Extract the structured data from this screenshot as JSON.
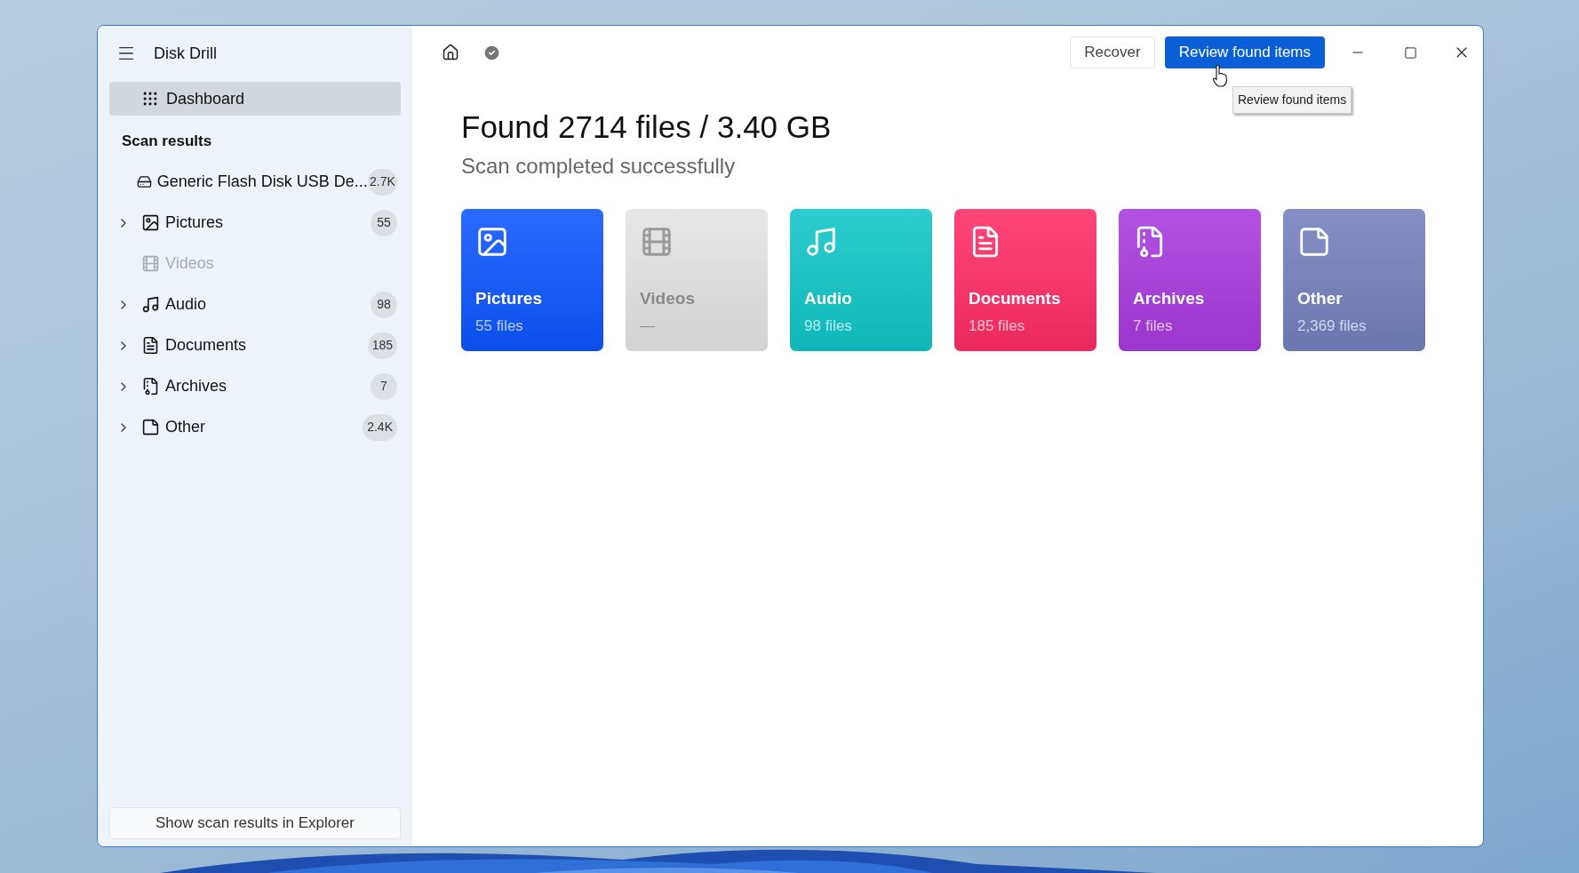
{
  "app": {
    "title": "Disk Drill"
  },
  "sidebar": {
    "items": [
      {
        "label": "Dashboard",
        "kind": "dashboard",
        "selected": true
      }
    ],
    "section_title": "Scan results",
    "results": [
      {
        "label": "Generic Flash Disk USB De...",
        "kind": "drive",
        "count": "2.7K",
        "expandable": false,
        "disabled": false
      },
      {
        "label": "Pictures",
        "kind": "pictures",
        "count": "55",
        "expandable": true,
        "disabled": false
      },
      {
        "label": "Videos",
        "kind": "videos",
        "expandable": false,
        "disabled": true
      },
      {
        "label": "Audio",
        "kind": "audio",
        "count": "98",
        "expandable": true,
        "disabled": false
      },
      {
        "label": "Documents",
        "kind": "documents",
        "count": "185",
        "expandable": true,
        "disabled": false
      },
      {
        "label": "Archives",
        "kind": "archives",
        "count": "7",
        "expandable": true,
        "disabled": false
      },
      {
        "label": "Other",
        "kind": "other",
        "count": "2.4K",
        "expandable": true,
        "disabled": false
      }
    ],
    "footer_button": "Show scan results in Explorer"
  },
  "toolbar": {
    "buttons": [
      "Recover",
      "Review found items"
    ],
    "tooltip": "Review found items"
  },
  "summary": {
    "title": "Found 2714 files / 3.40 GB",
    "subtitle": "Scan completed successfully"
  },
  "cards": [
    {
      "kind": "pictures",
      "title": "Pictures",
      "detail": "55 files",
      "color": "#0d55ff",
      "disabled": false
    },
    {
      "kind": "videos",
      "title": "Videos",
      "detail": "—",
      "color": "#e4e4e4",
      "disabled": true
    },
    {
      "kind": "audio",
      "title": "Audio",
      "detail": "98 files",
      "color": "#10c6c8",
      "disabled": false
    },
    {
      "kind": "documents",
      "title": "Documents",
      "detail": "185 files",
      "color": "#ff2c66",
      "disabled": false
    },
    {
      "kind": "archives",
      "title": "Archives",
      "detail": "7 files",
      "color": "#a83ade",
      "disabled": false
    },
    {
      "kind": "other",
      "title": "Other",
      "detail": "2,369 files",
      "color": "#7381bd",
      "disabled": false
    }
  ]
}
